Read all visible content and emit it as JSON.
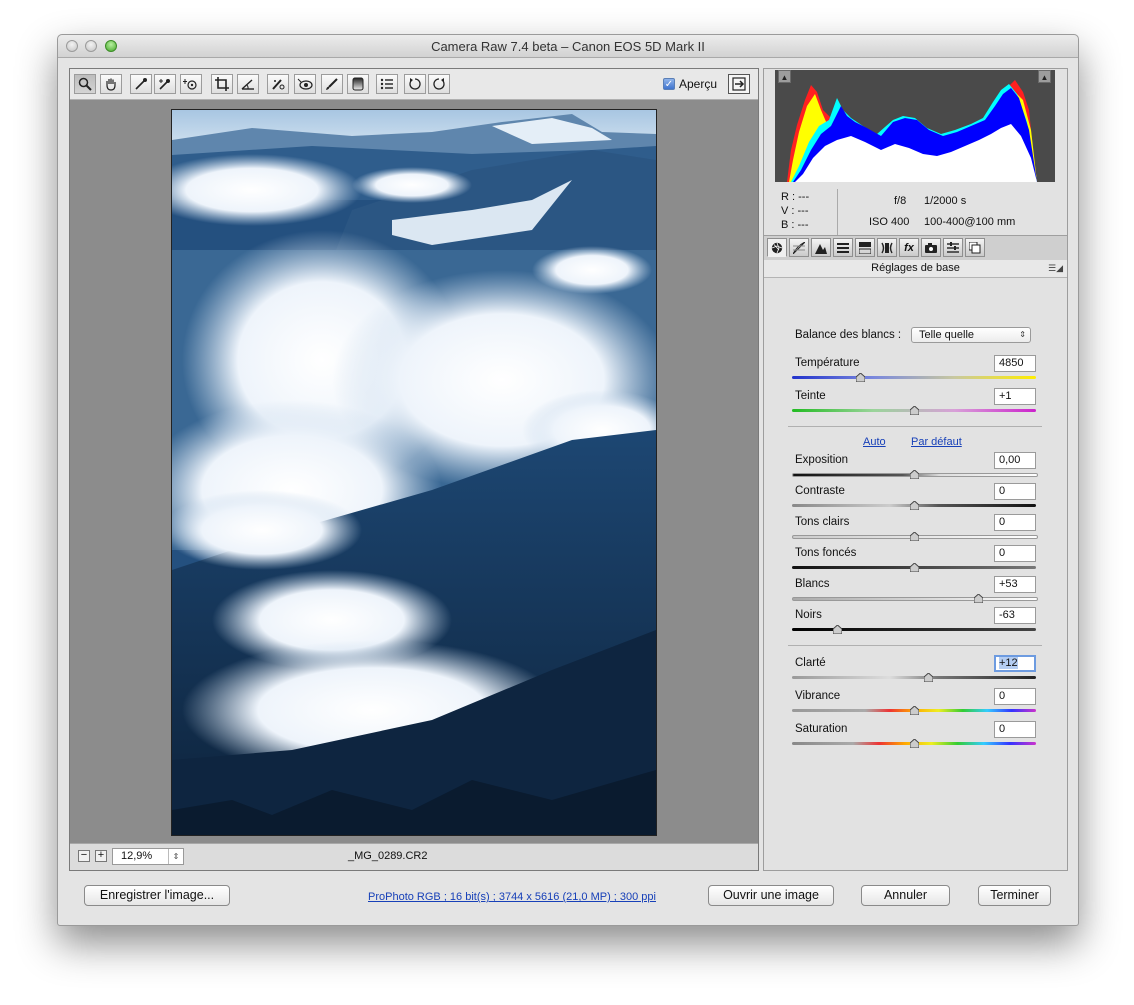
{
  "window": {
    "title": "Camera Raw 7.4 beta  –  Canon EOS 5D Mark II"
  },
  "toolbar": {
    "tools": [
      "zoom-tool",
      "hand-tool",
      "white-balance-tool",
      "color-sampler-tool",
      "targeted-adjustment-tool",
      "crop-tool",
      "straighten-tool",
      "spot-removal-tool",
      "red-eye-tool",
      "adjustment-brush-tool",
      "graduated-filter-tool",
      "open-preferences-tool",
      "rotate-left-tool",
      "rotate-right-tool"
    ],
    "preview_label": "Aperçu",
    "preview_checked": true
  },
  "status": {
    "zoom": "12,9%",
    "filename": "_MG_0289.CR2"
  },
  "info": {
    "r_label": "R :",
    "r_value": "---",
    "v_label": "V :",
    "v_value": "---",
    "b_label": "B :",
    "b_value": "---",
    "aperture": "f/8",
    "shutter": "1/2000 s",
    "iso": "ISO 400",
    "lens": "100-400@100 mm"
  },
  "panel": {
    "title": "Réglages de base",
    "white_balance_label": "Balance des blancs :",
    "white_balance_value": "Telle quelle",
    "auto_label": "Auto",
    "default_label": "Par défaut"
  },
  "sliders": [
    {
      "label": "Température",
      "value": "4850",
      "position": 0.28
    },
    {
      "label": "Teinte",
      "value": "+1",
      "position": 0.5
    },
    {
      "label": "Exposition",
      "value": "0,00",
      "position": 0.5
    },
    {
      "label": "Contraste",
      "value": "0",
      "position": 0.5
    },
    {
      "label": "Tons clairs",
      "value": "0",
      "position": 0.5
    },
    {
      "label": "Tons foncés",
      "value": "0",
      "position": 0.5
    },
    {
      "label": "Blancs",
      "value": "+53",
      "position": 0.765
    },
    {
      "label": "Noirs",
      "value": "-63",
      "position": 0.185
    },
    {
      "label": "Clarté",
      "value": "+12",
      "position": 0.56
    },
    {
      "label": "Vibrance",
      "value": "0",
      "position": 0.5
    },
    {
      "label": "Saturation",
      "value": "0",
      "position": 0.5
    }
  ],
  "buttons": {
    "save": "Enregistrer l'image...",
    "workflow": "ProPhoto RGB ; 16 bit(s) ; 3744 x 5616 (21,0 MP) ; 300 ppi",
    "open": "Ouvrir une image",
    "cancel": "Annuler",
    "done": "Terminer"
  }
}
